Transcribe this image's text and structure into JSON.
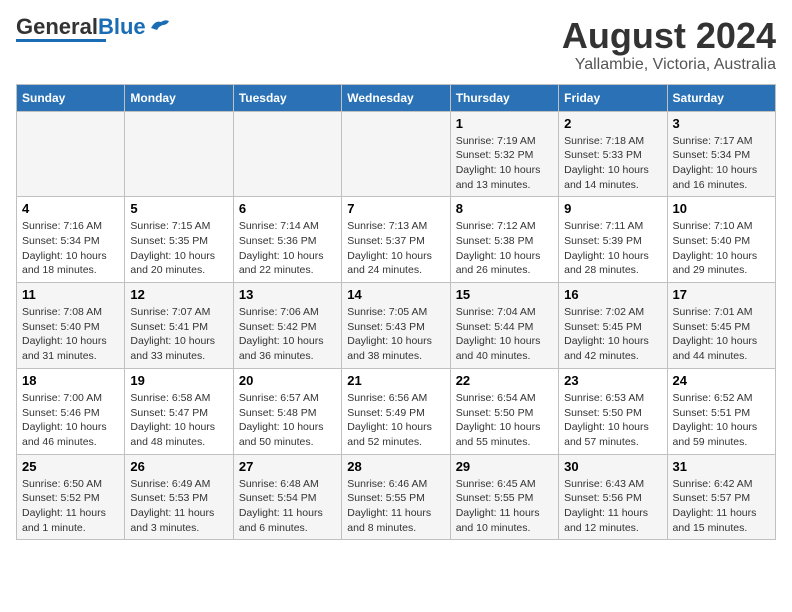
{
  "header": {
    "logo_general": "General",
    "logo_blue": "Blue",
    "title": "August 2024",
    "subtitle": "Yallambie, Victoria, Australia"
  },
  "days_of_week": [
    "Sunday",
    "Monday",
    "Tuesday",
    "Wednesday",
    "Thursday",
    "Friday",
    "Saturday"
  ],
  "weeks": [
    {
      "days": [
        {
          "number": "",
          "info": ""
        },
        {
          "number": "",
          "info": ""
        },
        {
          "number": "",
          "info": ""
        },
        {
          "number": "",
          "info": ""
        },
        {
          "number": "1",
          "info": "Sunrise: 7:19 AM\nSunset: 5:32 PM\nDaylight: 10 hours\nand 13 minutes."
        },
        {
          "number": "2",
          "info": "Sunrise: 7:18 AM\nSunset: 5:33 PM\nDaylight: 10 hours\nand 14 minutes."
        },
        {
          "number": "3",
          "info": "Sunrise: 7:17 AM\nSunset: 5:34 PM\nDaylight: 10 hours\nand 16 minutes."
        }
      ]
    },
    {
      "days": [
        {
          "number": "4",
          "info": "Sunrise: 7:16 AM\nSunset: 5:34 PM\nDaylight: 10 hours\nand 18 minutes."
        },
        {
          "number": "5",
          "info": "Sunrise: 7:15 AM\nSunset: 5:35 PM\nDaylight: 10 hours\nand 20 minutes."
        },
        {
          "number": "6",
          "info": "Sunrise: 7:14 AM\nSunset: 5:36 PM\nDaylight: 10 hours\nand 22 minutes."
        },
        {
          "number": "7",
          "info": "Sunrise: 7:13 AM\nSunset: 5:37 PM\nDaylight: 10 hours\nand 24 minutes."
        },
        {
          "number": "8",
          "info": "Sunrise: 7:12 AM\nSunset: 5:38 PM\nDaylight: 10 hours\nand 26 minutes."
        },
        {
          "number": "9",
          "info": "Sunrise: 7:11 AM\nSunset: 5:39 PM\nDaylight: 10 hours\nand 28 minutes."
        },
        {
          "number": "10",
          "info": "Sunrise: 7:10 AM\nSunset: 5:40 PM\nDaylight: 10 hours\nand 29 minutes."
        }
      ]
    },
    {
      "days": [
        {
          "number": "11",
          "info": "Sunrise: 7:08 AM\nSunset: 5:40 PM\nDaylight: 10 hours\nand 31 minutes."
        },
        {
          "number": "12",
          "info": "Sunrise: 7:07 AM\nSunset: 5:41 PM\nDaylight: 10 hours\nand 33 minutes."
        },
        {
          "number": "13",
          "info": "Sunrise: 7:06 AM\nSunset: 5:42 PM\nDaylight: 10 hours\nand 36 minutes."
        },
        {
          "number": "14",
          "info": "Sunrise: 7:05 AM\nSunset: 5:43 PM\nDaylight: 10 hours\nand 38 minutes."
        },
        {
          "number": "15",
          "info": "Sunrise: 7:04 AM\nSunset: 5:44 PM\nDaylight: 10 hours\nand 40 minutes."
        },
        {
          "number": "16",
          "info": "Sunrise: 7:02 AM\nSunset: 5:45 PM\nDaylight: 10 hours\nand 42 minutes."
        },
        {
          "number": "17",
          "info": "Sunrise: 7:01 AM\nSunset: 5:45 PM\nDaylight: 10 hours\nand 44 minutes."
        }
      ]
    },
    {
      "days": [
        {
          "number": "18",
          "info": "Sunrise: 7:00 AM\nSunset: 5:46 PM\nDaylight: 10 hours\nand 46 minutes."
        },
        {
          "number": "19",
          "info": "Sunrise: 6:58 AM\nSunset: 5:47 PM\nDaylight: 10 hours\nand 48 minutes."
        },
        {
          "number": "20",
          "info": "Sunrise: 6:57 AM\nSunset: 5:48 PM\nDaylight: 10 hours\nand 50 minutes."
        },
        {
          "number": "21",
          "info": "Sunrise: 6:56 AM\nSunset: 5:49 PM\nDaylight: 10 hours\nand 52 minutes."
        },
        {
          "number": "22",
          "info": "Sunrise: 6:54 AM\nSunset: 5:50 PM\nDaylight: 10 hours\nand 55 minutes."
        },
        {
          "number": "23",
          "info": "Sunrise: 6:53 AM\nSunset: 5:50 PM\nDaylight: 10 hours\nand 57 minutes."
        },
        {
          "number": "24",
          "info": "Sunrise: 6:52 AM\nSunset: 5:51 PM\nDaylight: 10 hours\nand 59 minutes."
        }
      ]
    },
    {
      "days": [
        {
          "number": "25",
          "info": "Sunrise: 6:50 AM\nSunset: 5:52 PM\nDaylight: 11 hours\nand 1 minute."
        },
        {
          "number": "26",
          "info": "Sunrise: 6:49 AM\nSunset: 5:53 PM\nDaylight: 11 hours\nand 3 minutes."
        },
        {
          "number": "27",
          "info": "Sunrise: 6:48 AM\nSunset: 5:54 PM\nDaylight: 11 hours\nand 6 minutes."
        },
        {
          "number": "28",
          "info": "Sunrise: 6:46 AM\nSunset: 5:55 PM\nDaylight: 11 hours\nand 8 minutes."
        },
        {
          "number": "29",
          "info": "Sunrise: 6:45 AM\nSunset: 5:55 PM\nDaylight: 11 hours\nand 10 minutes."
        },
        {
          "number": "30",
          "info": "Sunrise: 6:43 AM\nSunset: 5:56 PM\nDaylight: 11 hours\nand 12 minutes."
        },
        {
          "number": "31",
          "info": "Sunrise: 6:42 AM\nSunset: 5:57 PM\nDaylight: 11 hours\nand 15 minutes."
        }
      ]
    }
  ]
}
